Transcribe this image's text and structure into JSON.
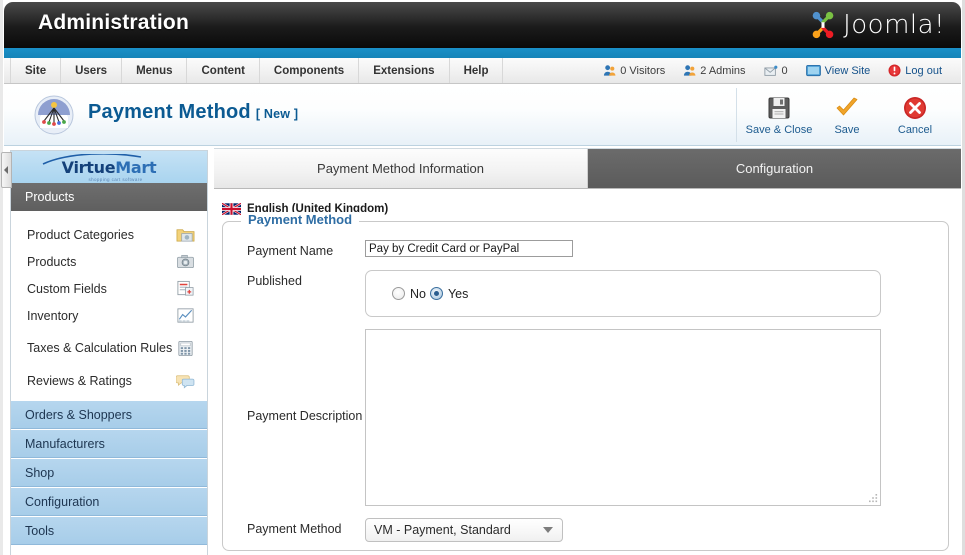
{
  "header": {
    "title": "Administration",
    "brand": "Joomla!"
  },
  "menubar": {
    "items": [
      {
        "label": "Site"
      },
      {
        "label": "Users"
      },
      {
        "label": "Menus"
      },
      {
        "label": "Content"
      },
      {
        "label": "Components"
      },
      {
        "label": "Extensions"
      },
      {
        "label": "Help"
      }
    ],
    "status": [
      {
        "icon": "visitors-icon",
        "label": "0 Visitors"
      },
      {
        "icon": "admins-icon",
        "label": "2 Admins"
      },
      {
        "icon": "messages-icon",
        "label": "0"
      },
      {
        "icon": "view-site-icon",
        "label": "View Site"
      },
      {
        "icon": "logout-icon",
        "label": "Log out"
      }
    ]
  },
  "page": {
    "icon": "payment-method-icon",
    "title": "Payment Method",
    "state": "[ New ]"
  },
  "toolbar": {
    "buttons": [
      {
        "icon": "save-close-icon",
        "label": "Save & Close"
      },
      {
        "icon": "save-icon",
        "label": "Save"
      },
      {
        "icon": "cancel-icon",
        "label": "Cancel"
      }
    ]
  },
  "sidebar": {
    "logo": {
      "text_a": "Virtue",
      "text_b": "Mart",
      "tagline": "shopping cart software"
    },
    "active_section": "Products",
    "links": [
      {
        "label": "Product Categories",
        "icon": "folder-icon"
      },
      {
        "label": "Products",
        "icon": "camera-icon"
      },
      {
        "label": "Custom Fields",
        "icon": "custom-fields-icon"
      },
      {
        "label": "Inventory",
        "icon": "chart-icon"
      },
      {
        "label": "Taxes & Calculation Rules",
        "icon": "calculator-icon"
      },
      {
        "label": "Reviews & Ratings",
        "icon": "comments-icon"
      }
    ],
    "sections": [
      {
        "label": "Orders & Shoppers"
      },
      {
        "label": "Manufacturers"
      },
      {
        "label": "Shop"
      },
      {
        "label": "Configuration"
      },
      {
        "label": "Tools"
      }
    ]
  },
  "main": {
    "tabs": [
      {
        "label": "Payment Method Information",
        "active": true
      },
      {
        "label": "Configuration",
        "active": false
      }
    ],
    "language": {
      "flag": "uk-flag-icon",
      "label": "English (United Kingdom)"
    },
    "fieldset_legend": "Payment Method",
    "fields": {
      "payment_name": {
        "label": "Payment Name",
        "value": "Pay by Credit Card or PayPal",
        "placeholder": ""
      },
      "published": {
        "label": "Published",
        "options": [
          {
            "label": "No",
            "checked": false
          },
          {
            "label": "Yes",
            "checked": true
          }
        ]
      },
      "payment_description": {
        "label": "Payment Description",
        "value": "",
        "placeholder": ""
      },
      "payment_method": {
        "label": "Payment Method",
        "value": "VM - Payment, Standard"
      }
    }
  },
  "colors": {
    "accent_blue": "#1a90c8",
    "title_blue": "#0b5a92",
    "legend_blue": "#2e6da4",
    "dark_header": "#1b1b1b",
    "tab_inactive": "#5b5b5b",
    "sidebar_section": "#a7cde9"
  }
}
